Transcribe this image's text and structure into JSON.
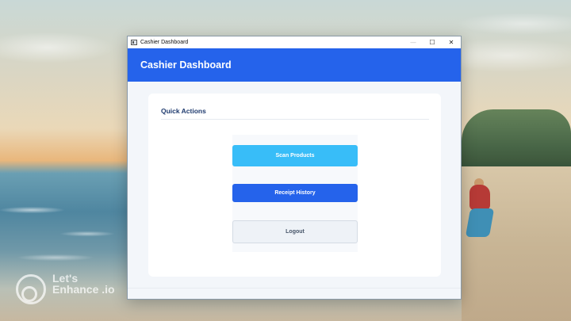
{
  "window": {
    "title": "Cashier Dashboard",
    "controls": {
      "minimize": "—",
      "maximize": "☐",
      "close": "✕"
    }
  },
  "header": {
    "title": "Cashier Dashboard"
  },
  "quick_actions": {
    "title": "Quick Actions",
    "buttons": {
      "scan": "Scan Products",
      "receipt": "Receipt History",
      "logout": "Logout"
    }
  },
  "watermark": {
    "text": "Let's Enhance .io"
  },
  "colors": {
    "header": "#2563eb",
    "scan_button": "#38bdf8",
    "receipt_button": "#2563eb",
    "logout_button": "#eef2f7",
    "content_background": "#f3f6fa"
  },
  "icons": {
    "app": "window-app-icon",
    "minimize": "minimize-icon",
    "maximize": "maximize-icon",
    "close": "close-icon"
  }
}
